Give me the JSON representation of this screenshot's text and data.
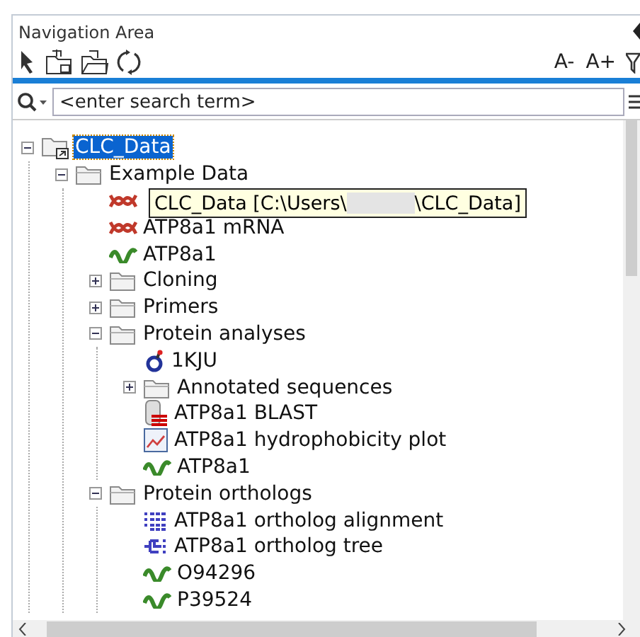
{
  "panel": {
    "title": "Navigation Area"
  },
  "toolbar": {
    "font_buttons": [
      "A-",
      "A+"
    ]
  },
  "search": {
    "placeholder": "<enter search term>"
  },
  "tree": [
    {
      "label": "CLC_Data",
      "kind": "root",
      "selected": true,
      "expanded": true,
      "children": [
        {
          "label": "Example Data",
          "kind": "folder",
          "selected": false,
          "expanded": true,
          "children": [
            {
              "kind": "nucleotide",
              "selected": false
            },
            {
              "label": "ATP8a1 mRNA",
              "kind": "nucleotide",
              "selected": false
            },
            {
              "label": "ATP8a1",
              "kind": "protein",
              "selected": false
            },
            {
              "label": "Cloning",
              "kind": "folder",
              "selected": false,
              "expanded": false
            },
            {
              "label": "Primers",
              "kind": "folder",
              "selected": false,
              "expanded": false
            },
            {
              "label": "Protein analyses",
              "kind": "folder",
              "selected": false,
              "expanded": true,
              "children": [
                {
                  "label": "1KJU",
                  "kind": "structure",
                  "selected": false
                },
                {
                  "label": "Annotated sequences",
                  "kind": "folder",
                  "selected": false,
                  "expanded": false
                },
                {
                  "label": "ATP8a1 BLAST",
                  "kind": "blast",
                  "selected": false
                },
                {
                  "label": "ATP8a1 hydrophobicity plot",
                  "kind": "plot",
                  "selected": false
                },
                {
                  "label": "ATP8a1",
                  "kind": "protein",
                  "selected": false
                }
              ]
            },
            {
              "label": "Protein orthologs",
              "kind": "folder",
              "selected": false,
              "expanded": true,
              "children": [
                {
                  "label": "ATP8a1 ortholog alignment",
                  "kind": "alignment",
                  "selected": false
                },
                {
                  "label": "ATP8a1 ortholog tree",
                  "kind": "phylo",
                  "selected": false
                },
                {
                  "label": "O94296",
                  "kind": "protein",
                  "selected": false
                },
                {
                  "label": "P39524",
                  "kind": "protein",
                  "selected": false
                }
              ]
            }
          ]
        }
      ]
    }
  ],
  "tooltip": {
    "text_before": "CLC_Data [C:\\Users\\",
    "text_after": "\\CLC_Data]"
  }
}
